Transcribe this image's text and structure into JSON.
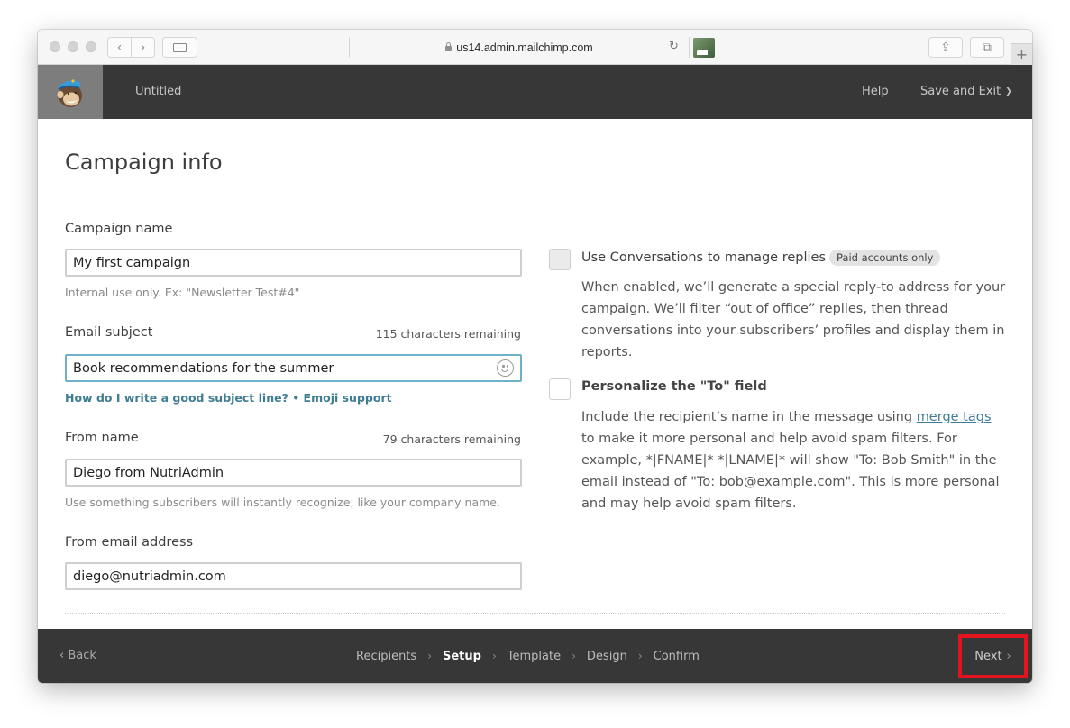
{
  "browser": {
    "url": "us14.admin.mailchimp.com",
    "icons": [
      "back-icon",
      "forward-icon",
      "sidebar-icon",
      "lock-icon",
      "reload-icon",
      "extension-icon",
      "share-icon",
      "tabs-icon",
      "new-tab-icon"
    ],
    "glyphs": {
      "back": "‹",
      "forward": "›",
      "reload": "↻",
      "share": "⇪",
      "tabs": "⧉",
      "new_tab": "+"
    }
  },
  "header": {
    "logo": "mailchimp-freddie-logo",
    "doc_title": "Untitled",
    "help": "Help",
    "save_exit": "Save and Exit",
    "save_exit_chevron": "⌄"
  },
  "page": {
    "title": "Campaign info"
  },
  "form": {
    "campaign_name": {
      "label": "Campaign name",
      "value": "My first campaign",
      "hint": "Internal use only. Ex: \"Newsletter Test#4\""
    },
    "email_subject": {
      "label": "Email subject",
      "counter": "115 characters remaining",
      "value": "Book recommendations for the summer",
      "help_link": "How do I write a good subject line?",
      "separator": " • ",
      "emoji_link": "Emoji support"
    },
    "from_name": {
      "label": "From name",
      "counter": "79 characters remaining",
      "value": "Diego from NutriAdmin",
      "hint": "Use something subscribers will instantly recognize, like your company name."
    },
    "from_email": {
      "label": "From email address",
      "value": "diego@nutriadmin.com"
    }
  },
  "options": {
    "conversations": {
      "title": "Use Conversations to manage replies",
      "badge": "Paid accounts only",
      "checked": false,
      "disabled": true,
      "description": "When enabled, we’ll generate a special reply-to address for your campaign. We’ll filter “out of office” replies, then thread conversations into your subscribers’ profiles and display them in reports."
    },
    "personalize_to": {
      "title": "Personalize the \"To\" field",
      "checked": false,
      "desc_before": "Include the recipient’s name in the message using ",
      "desc_link": "merge tags",
      "desc_after": " to make it more personal and help avoid spam filters. For example, *|FNAME|* *|LNAME|* will show \"To: Bob Smith\" in the email instead of \"To: bob@example.com\". This is more personal and may help avoid spam filters."
    }
  },
  "footer": {
    "back": "Back",
    "back_chevron": "‹",
    "steps": [
      "Recipients",
      "Setup",
      "Template",
      "Design",
      "Confirm"
    ],
    "active_step": "Setup",
    "step_separator": "›",
    "next": "Next",
    "next_chevron": "›",
    "highlight_color": "#e4141e"
  }
}
